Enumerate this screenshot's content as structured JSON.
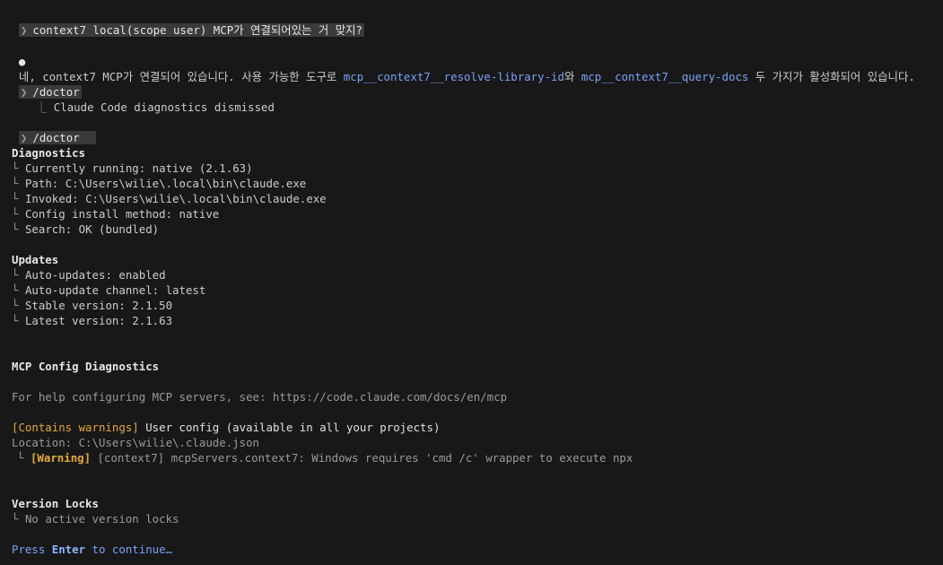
{
  "prompt1": {
    "glyph": "❯",
    "text": "context7 local(scope user) MCP가 연결되어있는 거 맞지?"
  },
  "response1": {
    "bullet": "●",
    "pre": "네, context7 MCP가 연결되어 있습니다. 사용 가능한 도구로 ",
    "tool1": "mcp__context7__resolve-library-id",
    "mid1": "와 ",
    "tool2": "mcp__context7__query-docs",
    "post": " 두 가지가 활성화되어 있습니다."
  },
  "prompt2": {
    "glyph": "❯",
    "text": "/doctor",
    "result_tree": "⎿",
    "result": "Claude Code diagnostics dismissed"
  },
  "prompt3": {
    "glyph": "❯",
    "text": "/doctor"
  },
  "diagnostics": {
    "title": "Diagnostics",
    "tree": "└",
    "items": [
      "Currently running: native (2.1.63)",
      "Path: C:\\Users\\wilie\\.local\\bin\\claude.exe",
      "Invoked: C:\\Users\\wilie\\.local\\bin\\claude.exe",
      "Config install method: native",
      "Search: OK (bundled)"
    ]
  },
  "updates": {
    "title": "Updates",
    "items": [
      "Auto-updates: enabled",
      "Auto-update channel: latest",
      "Stable version: 2.1.50",
      "Latest version: 2.1.63"
    ]
  },
  "mcp": {
    "title": "MCP Config Diagnostics",
    "help": "For help configuring MCP servers, see: https://code.claude.com/docs/en/mcp",
    "warn_tag": "[Contains warnings]",
    "config_label": " User config (available in all your projects)",
    "location": "Location: C:\\Users\\wilie\\.claude.json",
    "warning_tag": "[Warning]",
    "warning_text": " [context7] mcpServers.context7: Windows requires 'cmd /c' wrapper to execute npx"
  },
  "version_locks": {
    "title": "Version Locks",
    "item": "No active version locks"
  },
  "footer": {
    "press": "Press ",
    "key": "Enter",
    "rest": " to continue…"
  },
  "colors": {
    "background": "#181818",
    "prompt_bg": "#3a3a3a",
    "tool_blue": "#7aa2f7",
    "warning": "#e5a93b"
  }
}
